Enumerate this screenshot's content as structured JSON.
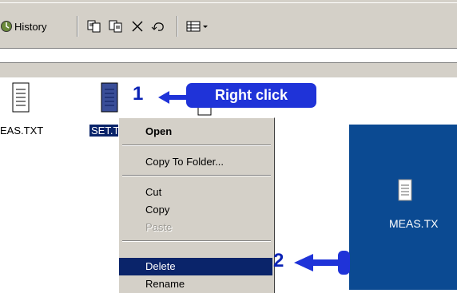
{
  "toolbar": {
    "history_label": "History",
    "icons": [
      "move-to-icon",
      "copy-to-icon",
      "delete-icon",
      "undo-icon",
      "views-icon"
    ]
  },
  "files": [
    {
      "name": "MEAS.TXT",
      "label": "EAS.TXT"
    },
    {
      "name": "SET.TXT",
      "label": "SET.T"
    }
  ],
  "annotations": {
    "step1": "1",
    "step1_label": "Right click",
    "step2": "2",
    "colors": {
      "callout": "#1f33d8",
      "number": "#0b23b5"
    }
  },
  "context_menu": {
    "items": [
      {
        "label": "Open",
        "bold": true
      },
      {
        "label": "Copy To Folder..."
      },
      {
        "label": "Cut"
      },
      {
        "label": "Copy"
      },
      {
        "label": "Paste",
        "disabled": true
      },
      {
        "label": "Delete",
        "selected": true
      },
      {
        "label": "Rename"
      }
    ]
  },
  "desktop": {
    "file_label": "MEAS.TX",
    "background": "#0b4a92"
  }
}
